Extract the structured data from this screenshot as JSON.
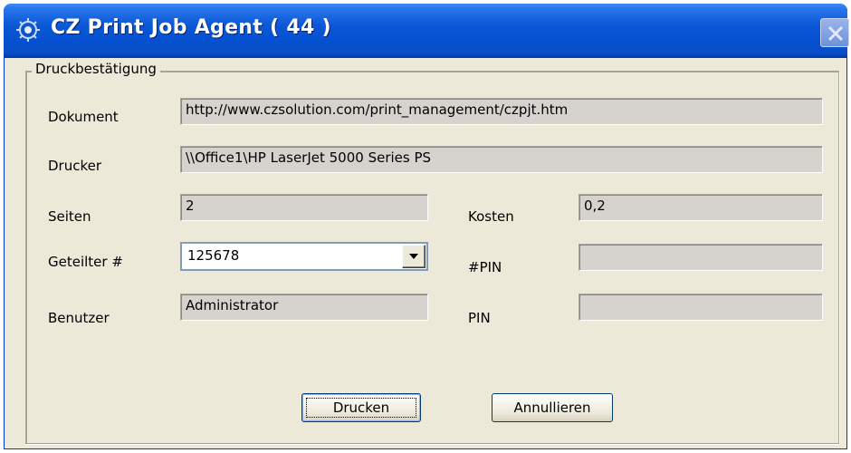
{
  "window": {
    "title": "CZ Print Job Agent ( 44 )"
  },
  "group": {
    "legend": "Druckbestätigung"
  },
  "fields": {
    "dokument_label": "Dokument",
    "dokument_value": "http://www.czsolution.com/print_management/czpjt.htm",
    "drucker_label": "Drucker",
    "drucker_value": "\\\\Office1\\HP LaserJet 5000 Series PS",
    "seiten_label": "Seiten",
    "seiten_value": "2",
    "kosten_label": "Kosten",
    "kosten_value": "0,2",
    "geteilter_label": "Geteilter #",
    "geteilter_value": "125678",
    "pin_hash_label": "#PIN",
    "pin_hash_value": "",
    "benutzer_label": "Benutzer",
    "benutzer_value": "Administrator",
    "pin_label": "PIN",
    "pin_value": ""
  },
  "buttons": {
    "print_label": "Drucken",
    "cancel_label": "Annullieren"
  },
  "icons": {
    "title_icon": "printer-agent-icon",
    "close_icon": "close-icon",
    "dropdown_icon": "chevron-down-icon"
  }
}
